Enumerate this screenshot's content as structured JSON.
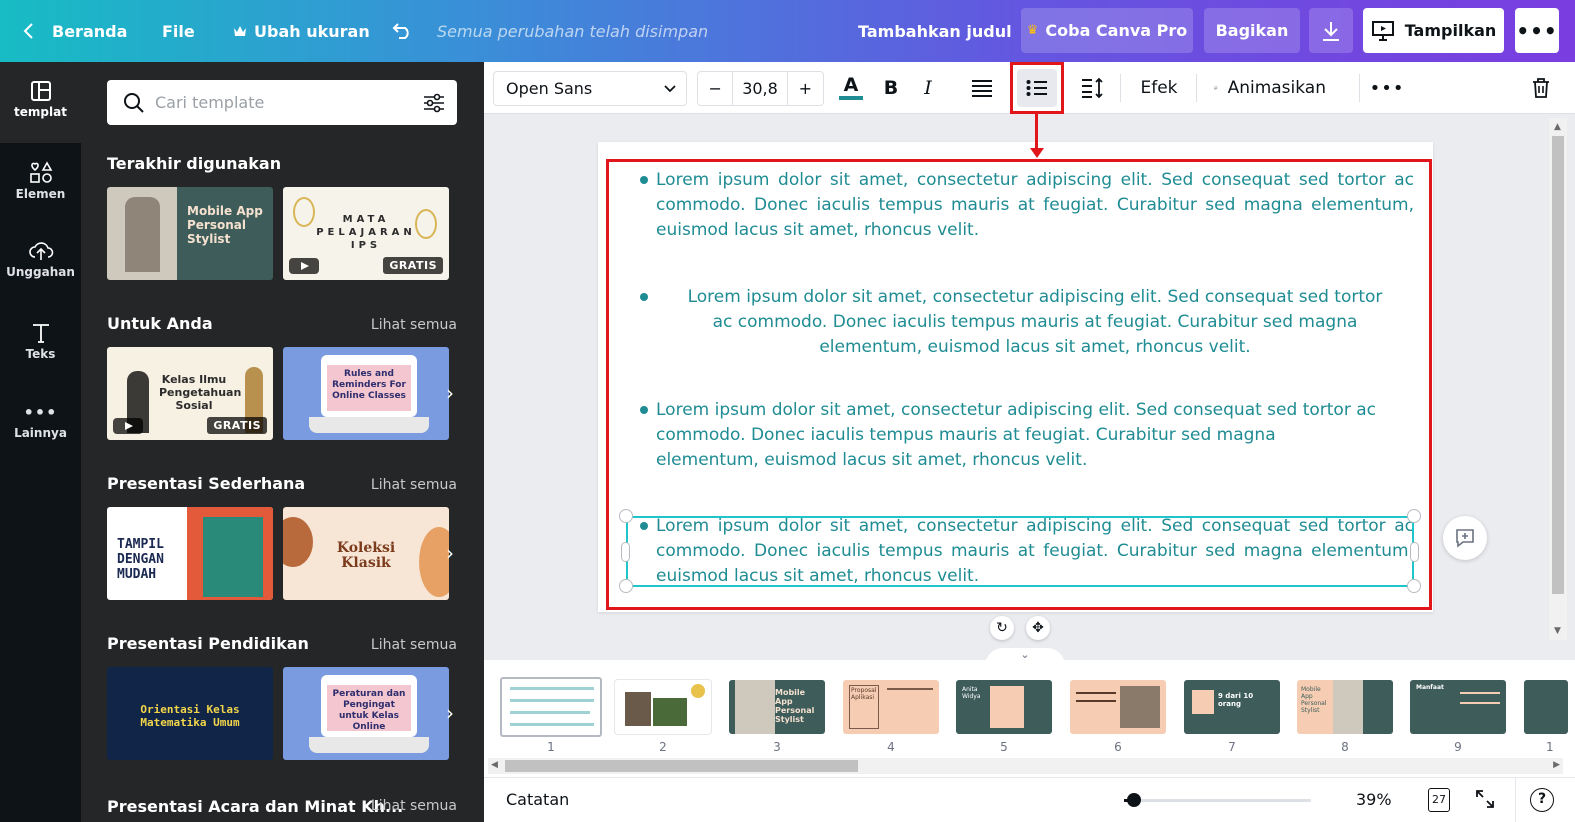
{
  "header": {
    "home_label": "Beranda",
    "file_label": "File",
    "resize_label": "Ubah ukuran",
    "saved_status": "Semua perubahan telah disimpan",
    "title_label": "Tambahkan judul",
    "pro_label": "Coba Canva Pro",
    "share_label": "Bagikan",
    "present_label": "Tampilkan"
  },
  "rail": {
    "items": [
      {
        "label": "templat",
        "icon": "template-icon"
      },
      {
        "label": "Elemen",
        "icon": "elements-icon"
      },
      {
        "label": "Unggahan",
        "icon": "upload-icon"
      },
      {
        "label": "Teks",
        "icon": "text-icon"
      },
      {
        "label": "Lainnya",
        "icon": "more-icon"
      }
    ]
  },
  "panel": {
    "search_placeholder": "Cari template",
    "see_all": "Lihat semua",
    "sections": [
      {
        "title": "Terakhir digunakan"
      },
      {
        "title": "Untuk Anda"
      },
      {
        "title": "Presentasi Sederhana"
      },
      {
        "title": "Presentasi Pendidikan"
      },
      {
        "title": "Presentasi Acara dan Minat Kh..."
      }
    ],
    "thumbs": {
      "t1": "Mobile App Personal Stylist",
      "t2": "MATA PELAJARAN IPS",
      "t3": "Kelas Ilmu Pengetahuan Sosial",
      "t4": "Rules and Reminders For Online Classes",
      "t5": "TAMPIL DENGAN MUDAH",
      "t6": "Koleksi Klasik",
      "t7": "Orientasi Kelas Matematika Umum",
      "t8": "Peraturan dan Pengingat untuk Kelas Online"
    },
    "free_badge": "GRATIS"
  },
  "toolbar": {
    "font": "Open Sans",
    "font_size": "30,8",
    "minus": "−",
    "plus": "+",
    "bold": "B",
    "italic": "I",
    "effects": "Efek",
    "animate": "Animasikan"
  },
  "canvas": {
    "bullets": [
      "Lorem ipsum dolor sit amet, consectetur adipiscing elit. Sed consequat sed tortor ac commodo. Donec iaculis tempus mauris at feugiat. Curabitur sed magna elementum, euismod lacus sit amet, rhoncus velit.",
      "Lorem ipsum dolor sit amet, consectetur adipiscing elit. Sed consequat sed tortor ac commodo. Donec iaculis tempus mauris at feugiat. Curabitur sed magna elementum, euismod lacus sit amet, rhoncus velit.",
      "Lorem ipsum dolor sit amet, consectetur adipiscing elit. Sed consequat sed tortor ac commodo. Donec iaculis tempus mauris at feugiat. Curabitur sed magna elementum, euismod lacus sit amet, rhoncus velit.",
      "Lorem ipsum dolor sit amet, consectetur adipiscing elit. Sed consequat sed tortor ac commodo. Donec iaculis tempus mauris at feugiat. Curabitur sed magna elementum, euismod lacus sit amet, rhoncus velit."
    ]
  },
  "filmstrip": {
    "numbers": [
      "1",
      "2",
      "3",
      "4",
      "5",
      "6",
      "7",
      "8",
      "9",
      "1"
    ],
    "s3": "Mobile App Personal Stylist",
    "s4": "Proposal Aplikasi",
    "s5": "Anita Widya",
    "s7": "9 dari 10 orang",
    "s8": "Mobile App Personal Stylist",
    "s9": "Manfaat"
  },
  "footer": {
    "notes_label": "Catatan",
    "zoom": "39%",
    "page_count": "27"
  }
}
